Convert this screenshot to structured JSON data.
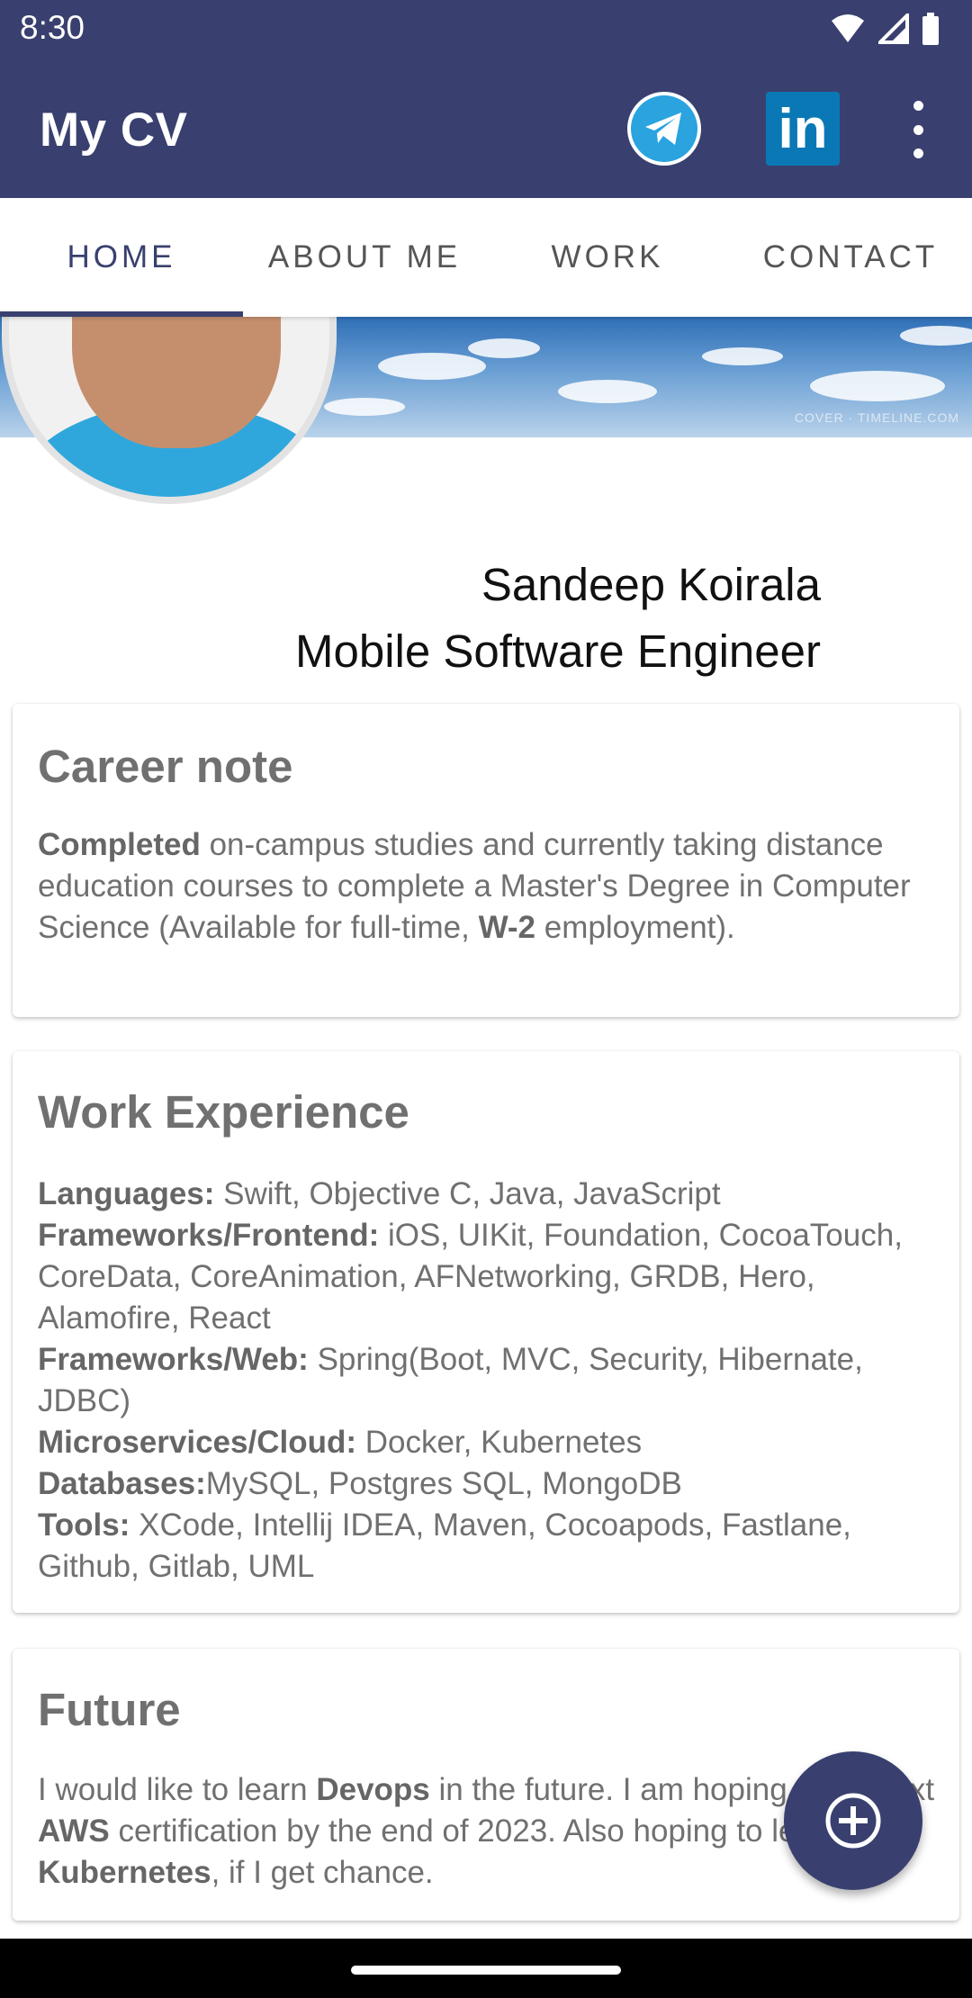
{
  "status": {
    "time": "8:30"
  },
  "appbar": {
    "title": "My CV",
    "telegram_icon": "telegram-icon",
    "linkedin_label": "in",
    "more_icon": "more-vert-icon"
  },
  "tabs": [
    {
      "label": "HOME",
      "active": true
    },
    {
      "label": "ABOUT ME",
      "active": false
    },
    {
      "label": "WORK",
      "active": false
    },
    {
      "label": "CONTACT",
      "active": false
    }
  ],
  "cover": {
    "watermark": "COVER · TIMELINE.COM"
  },
  "profile": {
    "name": "Sandeep Koirala",
    "role": "Mobile Software Engineer"
  },
  "career": {
    "title": "Career note",
    "strong1": "Completed",
    "text1": " on-campus studies and currently taking distance education courses to complete a Master's Degree in Computer Science (Available for full-time, ",
    "strong2": "W-2",
    "text2": " employment)."
  },
  "work": {
    "title": "Work Experience",
    "rows": [
      {
        "label": "Languages:",
        "value": " Swift, Objective C, Java, JavaScript"
      },
      {
        "label": "Frameworks/Frontend:",
        "value": " iOS, UIKit, Foundation, CocoaTouch, CoreData, CoreAnimation, AFNetworking, GRDB, Hero, Alamofire, React"
      },
      {
        "label": "Frameworks/Web:",
        "value": " Spring(Boot, MVC, Security, Hibernate, JDBC)"
      },
      {
        "label": "Microservices/Cloud:",
        "value": " Docker, Kubernetes"
      },
      {
        "label": "Databases:",
        "value": "MySQL, Postgres SQL, MongoDB"
      },
      {
        "label": "Tools:",
        "value": " XCode, Intellij IDEA, Maven, Cocoapods, Fastlane, Github, Gitlab, UML"
      }
    ]
  },
  "future": {
    "title": "Future",
    "t1": "I would like to learn ",
    "s1": "Devops",
    "t2": " in the future. I am hoping to do next ",
    "s2": "AWS",
    "t3": " certification by the end of 2023. Also hoping to learn ",
    "s3": "Kubernetes",
    "t4": ", if I get chance."
  },
  "fab": {
    "icon": "add-circle-icon"
  },
  "colors": {
    "primary": "#39406f",
    "telegram": "#2aa3df",
    "linkedin": "#0b78b6"
  }
}
